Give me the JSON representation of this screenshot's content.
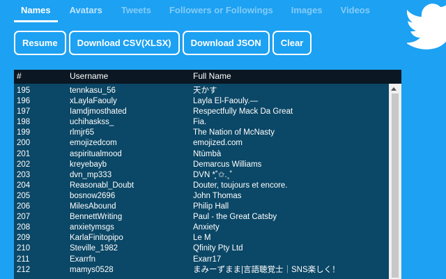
{
  "tabs": [
    {
      "label": "Names",
      "state": "active"
    },
    {
      "label": "Avatars",
      "state": "semi"
    },
    {
      "label": "Tweets",
      "state": "inactive"
    },
    {
      "label": "Followers or Followings",
      "state": "inactive"
    },
    {
      "label": "Images",
      "state": "inactive"
    },
    {
      "label": "Videos",
      "state": "inactive"
    }
  ],
  "buttons": {
    "resume": "Resume",
    "download_csv": "Download CSV(XLSX)",
    "download_json": "Download JSON",
    "clear": "Clear"
  },
  "table": {
    "headers": {
      "num": "#",
      "username": "Username",
      "full_name": "Full Name"
    },
    "rows": [
      {
        "num": "195",
        "username": "tennkasu_56",
        "full_name": "天かす"
      },
      {
        "num": "196",
        "username": "xLaylaFaouly",
        "full_name": "Layla El-Faouly.—"
      },
      {
        "num": "197",
        "username": "Iamdjmosthated",
        "full_name": "Respectfully Mack Da Great"
      },
      {
        "num": "198",
        "username": "uchihaskss_",
        "full_name": "Fia."
      },
      {
        "num": "199",
        "username": "rlmjr65",
        "full_name": "The Nation of McNasty"
      },
      {
        "num": "200",
        "username": "emojizedcom",
        "full_name": "emojized.com"
      },
      {
        "num": "201",
        "username": "aspiritualmood",
        "full_name": "Ntùmbà"
      },
      {
        "num": "202",
        "username": "kreyebayb",
        "full_name": "Demarcus Williams"
      },
      {
        "num": "203",
        "username": "dvn_mp333",
        "full_name": "DVN *̥˚✩.˳˚"
      },
      {
        "num": "204",
        "username": "Reasonabl_Doubt",
        "full_name": "Douter, toujours et encore."
      },
      {
        "num": "205",
        "username": "bosnow2696",
        "full_name": "John Thomas"
      },
      {
        "num": "206",
        "username": "MilesAbound",
        "full_name": "Philip Hall"
      },
      {
        "num": "207",
        "username": "BennettWriting",
        "full_name": "Paul - the Great Catsby"
      },
      {
        "num": "208",
        "username": "anxietymsgs",
        "full_name": "Anxiety"
      },
      {
        "num": "209",
        "username": "KarlaFinitopipo",
        "full_name": "Le M"
      },
      {
        "num": "210",
        "username": "Steville_1982",
        "full_name": "Qfinity Pty Ltd"
      },
      {
        "num": "211",
        "username": "Exarrfn",
        "full_name": "Exarr17"
      },
      {
        "num": "212",
        "username": "mamys0528",
        "full_name": "まみーずまま|言語聴覚士｜SNS楽しく！"
      }
    ]
  },
  "colors": {
    "background": "#1da1f2",
    "table_body": "#0b4766",
    "table_header": "#0b1722",
    "text": "#ffffff"
  },
  "icons": {
    "logo": "twitter-bird-icon",
    "scroll": "scroll-up-arrow-icon"
  }
}
